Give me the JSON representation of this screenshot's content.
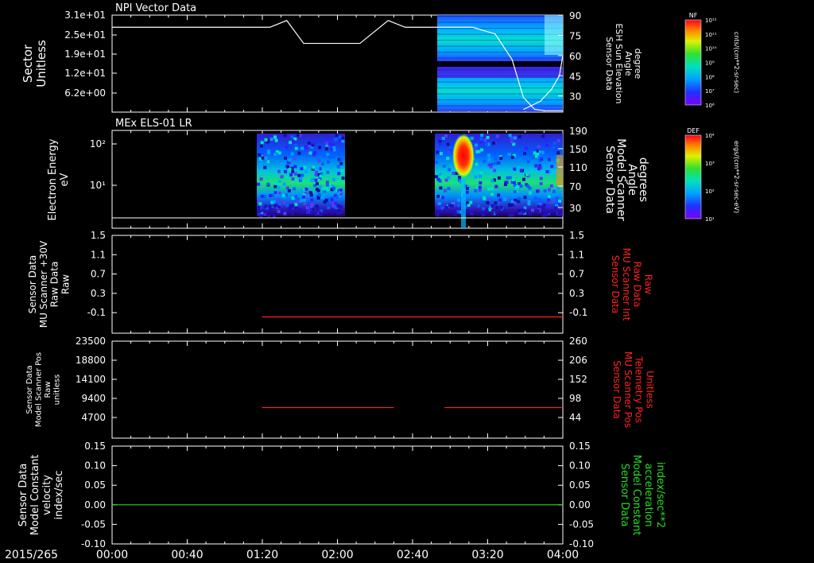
{
  "date_label": "2015/265",
  "time_ticks": [
    "00:00",
    "00:40",
    "01:20",
    "02:00",
    "02:40",
    "03:20",
    "04:00"
  ],
  "colors": {
    "white": "#ffffff",
    "red": "#ff2020",
    "green": "#22dd22"
  },
  "chart_data": [
    {
      "id": "p1",
      "title": "NPI Vector Data",
      "type": "line",
      "left_axis": {
        "label": [
          "Sector",
          "Unitless"
        ],
        "ticks": [
          "3.1e+01",
          "2.5e+01",
          "1.9e+01",
          "1.2e+01",
          "6.2e+00"
        ]
      },
      "right_axis": {
        "label": [
          "Sensor Data",
          "ESH Sun Elevation",
          "Angle",
          "degree"
        ],
        "ticks": [
          "90",
          "75",
          "60",
          "45",
          "30"
        ],
        "ylim": [
          18,
          90
        ]
      },
      "colorbar": {
        "title": "NF",
        "units": "cnts/(cm**2-sr-sec)",
        "ticks": [
          "10¹²",
          "10¹¹",
          "10¹⁰",
          "10⁹",
          "10⁸",
          "10⁷",
          "10⁶"
        ]
      },
      "series": [
        {
          "axis": "right",
          "color": "white",
          "x_hours": [
            0,
            0.5,
            1.0,
            1.4,
            1.55,
            1.7,
            1.85,
            2.2,
            2.45,
            2.6,
            2.75,
            3.2,
            3.4,
            3.55,
            3.65,
            3.75,
            3.85,
            3.95,
            4.0
          ],
          "y": [
            81,
            81,
            81,
            81,
            86,
            69,
            69,
            69,
            86,
            81,
            81,
            81,
            76,
            57,
            29,
            20,
            19,
            19,
            19
          ]
        },
        {
          "axis": "right",
          "color": "white",
          "x_hours": [
            3.65,
            3.8,
            3.9,
            3.97,
            4.0
          ],
          "y": [
            20,
            26,
            35,
            45,
            60
          ]
        }
      ]
    },
    {
      "id": "p2",
      "title": "MEx ELS-01 LR",
      "type": "heatmap",
      "left_axis": {
        "label": [
          "Electron Energy",
          "eV"
        ],
        "ticks": [
          "10²",
          "10¹"
        ]
      },
      "right_axis": {
        "label": [
          "Sensor Data",
          "Model Scanner",
          "Angle",
          "degrees"
        ],
        "ticks": [
          "190",
          "150",
          "110",
          "70",
          "30"
        ]
      },
      "colorbar": {
        "title": "DEF",
        "units": "ergs/(cm**2-sr-sec-eV)",
        "ticks": [
          "10⁴",
          "10³",
          "10²",
          "10¹"
        ]
      }
    },
    {
      "id": "p3",
      "type": "line",
      "left_axis": {
        "label": [
          "Sensor Data",
          "MU Scanner +30V",
          "Raw Data",
          "Raw"
        ],
        "ticks": [
          "1.5",
          "1.1",
          "0.7",
          "0.3",
          "-0.1"
        ],
        "ylim": [
          -0.3,
          1.5
        ]
      },
      "right_axis": {
        "label": [
          "Sensor Data",
          "MU Scanner Int",
          "Raw Data",
          "Raw"
        ],
        "ticks": [
          "1.5",
          "1.1",
          "0.7",
          "0.3",
          "-0.1"
        ],
        "color": "red"
      },
      "series": [
        {
          "axis": "left",
          "color": "red",
          "x_hours": [
            1.33,
            4.0
          ],
          "y": [
            0.0,
            0.0
          ]
        }
      ]
    },
    {
      "id": "p4",
      "type": "line",
      "left_axis": {
        "label": [
          "Sensor Data",
          "Model Scanner Pos",
          "Raw",
          "unitless"
        ],
        "ticks": [
          "23500",
          "18800",
          "14100",
          "9400",
          "4700"
        ],
        "ylim": [
          0,
          23500
        ]
      },
      "right_axis": {
        "label": [
          "Sensor Data",
          "MU Scanner Pos",
          "Telemetry Pos",
          "Unitless"
        ],
        "ticks": [
          "260",
          "206",
          "152",
          "98",
          "44"
        ],
        "color": "red"
      },
      "series": [
        {
          "axis": "left",
          "color": "red",
          "x_hours": [
            1.33,
            2.5
          ],
          "y": [
            7400,
            7400
          ]
        },
        {
          "axis": "left",
          "color": "red",
          "x_hours": [
            2.95,
            4.0
          ],
          "y": [
            7400,
            7400
          ]
        }
      ]
    },
    {
      "id": "p5",
      "type": "line",
      "left_axis": {
        "label": [
          "Sensor Data",
          "Model Constant",
          "velocity",
          "index/sec"
        ],
        "ticks": [
          "0.15",
          "0.10",
          "0.05",
          "0.00",
          "-0.05",
          "-0.10"
        ],
        "ylim": [
          -0.1,
          0.15
        ]
      },
      "right_axis": {
        "label": [
          "Sensor Data",
          "Model Constant",
          "acceleration",
          "index/sec**2"
        ],
        "ticks": [
          "0.15",
          "0.10",
          "0.05",
          "0.00",
          "-0.05",
          "-0.10"
        ],
        "color": "green"
      },
      "series": [
        {
          "axis": "left",
          "color": "green",
          "x_hours": [
            0,
            4.0
          ],
          "y": [
            0.0,
            0.0
          ]
        }
      ]
    }
  ]
}
